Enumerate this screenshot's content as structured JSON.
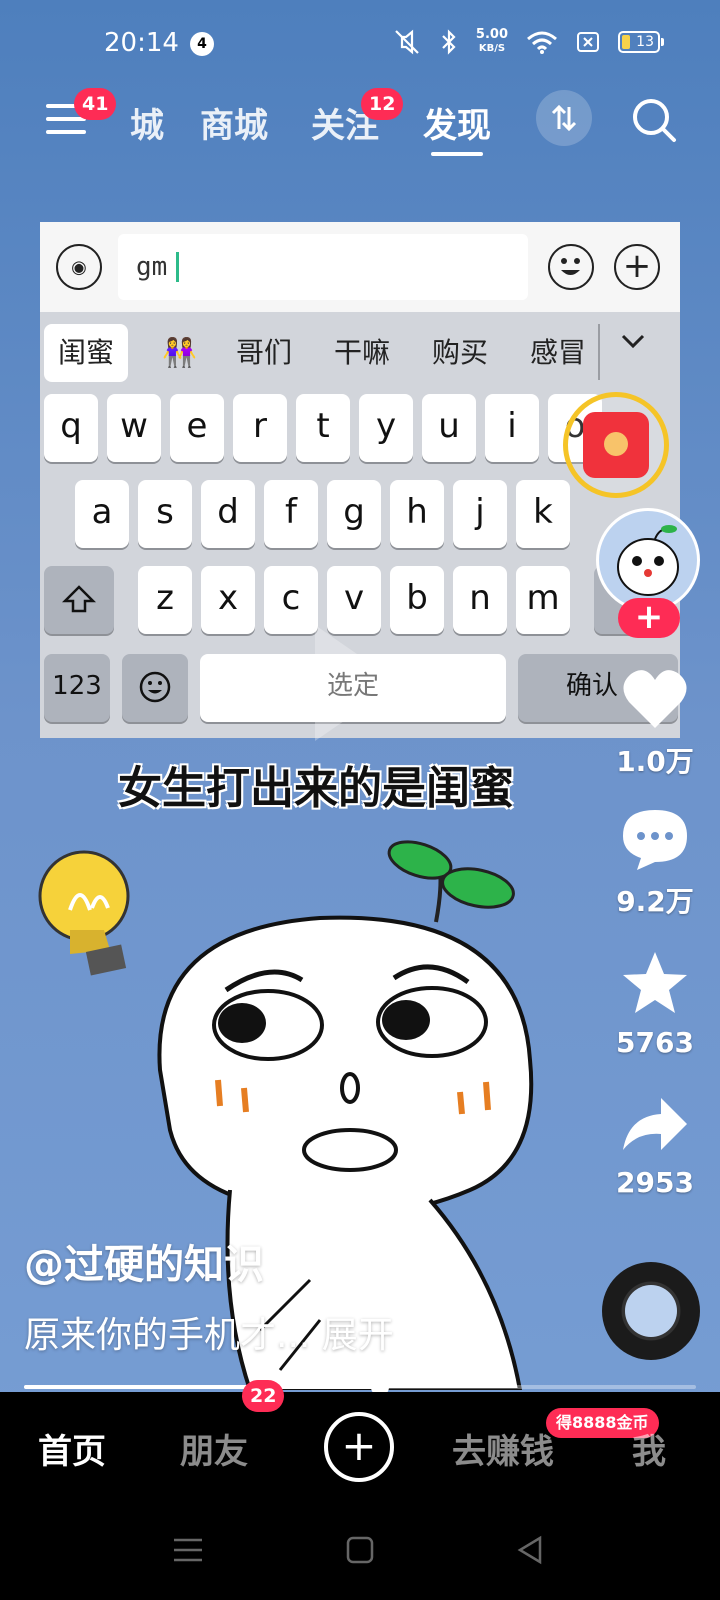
{
  "status_bar": {
    "time": "20:14",
    "notification_count": "4",
    "net_speed_value": "5.00",
    "net_speed_unit": "KB/S",
    "battery_level": "13"
  },
  "top_nav": {
    "menu_badge": "41",
    "tabs": [
      {
        "label": "城",
        "active": false
      },
      {
        "label": "商城",
        "active": false
      },
      {
        "label": "关注",
        "active": false,
        "badge": "12"
      },
      {
        "label": "发现",
        "active": true
      }
    ]
  },
  "video": {
    "keyboard": {
      "input_text": "gm",
      "candidates": [
        "闺蜜",
        "👭",
        "哥们",
        "干嘛",
        "购买",
        "感冒"
      ],
      "row1": [
        "q",
        "w",
        "e",
        "r",
        "t",
        "y",
        "u",
        "i",
        "o"
      ],
      "row2": [
        "a",
        "s",
        "d",
        "f",
        "g",
        "h",
        "j",
        "k"
      ],
      "row3": [
        "z",
        "x",
        "c",
        "v",
        "b",
        "n",
        "m"
      ],
      "num_key": "123",
      "space_key": "选定",
      "confirm_key": "确认"
    },
    "caption": "女生打出来的是闺蜜",
    "author": "@过硬的知识",
    "description": "原来你的手机才...",
    "expand_label": "展开",
    "progress": 0.53
  },
  "actions": {
    "likes": "1.0万",
    "comments": "9.2万",
    "favorites": "5763",
    "shares": "2953"
  },
  "bottom_tabs": {
    "home": "首页",
    "friends": "朋友",
    "friends_badge": "22",
    "earn": "去赚钱",
    "earn_badge": "得8888金币",
    "me": "我"
  },
  "colors": {
    "accent": "#fe2c55",
    "video_bg": "#6d93cb",
    "leaf": "#2db34a",
    "coin_ring": "#f5c427"
  }
}
